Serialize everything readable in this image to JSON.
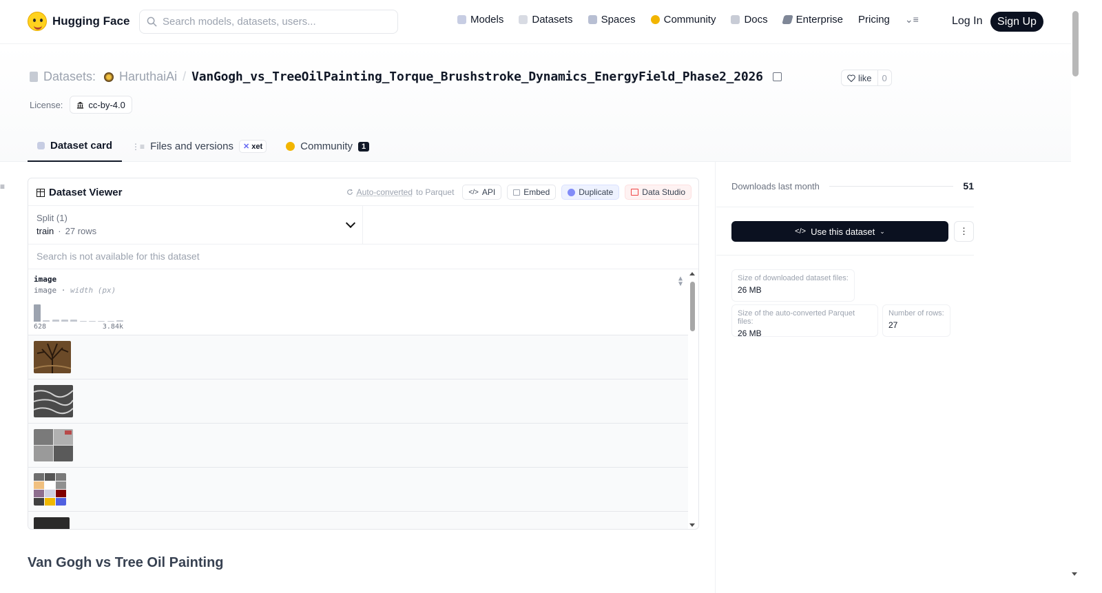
{
  "brand": {
    "name": "Hugging Face"
  },
  "search": {
    "placeholder": "Search models, datasets, users..."
  },
  "nav": {
    "items": [
      {
        "label": "Models",
        "icon": "cube-icon"
      },
      {
        "label": "Datasets",
        "icon": "database-icon"
      },
      {
        "label": "Spaces",
        "icon": "grid-icon"
      },
      {
        "label": "Community",
        "icon": "community-icon"
      },
      {
        "label": "Docs",
        "icon": "book-icon"
      },
      {
        "label": "Enterprise",
        "icon": "enterprise-icon"
      },
      {
        "label": "Pricing",
        "icon": ""
      }
    ],
    "login": "Log In",
    "signup": "Sign Up"
  },
  "header": {
    "section": "Datasets:",
    "owner": "HaruthaiAi",
    "slash": "/",
    "repo": "VanGogh_vs_TreeOilPainting_Torque_Brushstroke_Dynamics_EnergyField_Phase2_2026",
    "like_label": "like",
    "like_count": "0",
    "license_label": "License:",
    "license_value": "cc-by-4.0"
  },
  "tabs": [
    {
      "label": "Dataset card",
      "active": true
    },
    {
      "label": "Files and versions",
      "badge": "xet"
    },
    {
      "label": "Community",
      "count": "1"
    }
  ],
  "viewer": {
    "title": "Dataset Viewer",
    "autoconv_pre": "Auto-converted",
    "autoconv_post": "to Parquet",
    "api_label": "API",
    "embed_label": "Embed",
    "duplicate_label": "Duplicate",
    "studio_label": "Data Studio",
    "split_label": "Split (1)",
    "split_name": "train",
    "split_rows": "27 rows",
    "search_na": "Search is not available for this dataset",
    "column": {
      "name": "image",
      "type": "image",
      "stat": "width (px)",
      "hist_min": "628",
      "hist_max": "3.84k",
      "hist_values": [
        0.95,
        0.08,
        0.12,
        0.12,
        0.12,
        0.0,
        0.0,
        0.0,
        0.0,
        0.05
      ]
    },
    "row_count_visible": 5
  },
  "card": {
    "title": "Van Gogh vs Tree Oil Painting"
  },
  "sidebar": {
    "downloads_label": "Downloads last month",
    "downloads_value": "51",
    "use_label": "Use this dataset",
    "stats": [
      {
        "label": "Size of downloaded dataset files:",
        "value": "26 MB"
      },
      {
        "label": "Size of the auto-converted Parquet files:",
        "value": "26 MB"
      },
      {
        "label": "Number of rows:",
        "value": "27"
      }
    ]
  },
  "colors": {
    "accent_dark": "#0b1120",
    "brand_yellow": "#ffd21e"
  }
}
